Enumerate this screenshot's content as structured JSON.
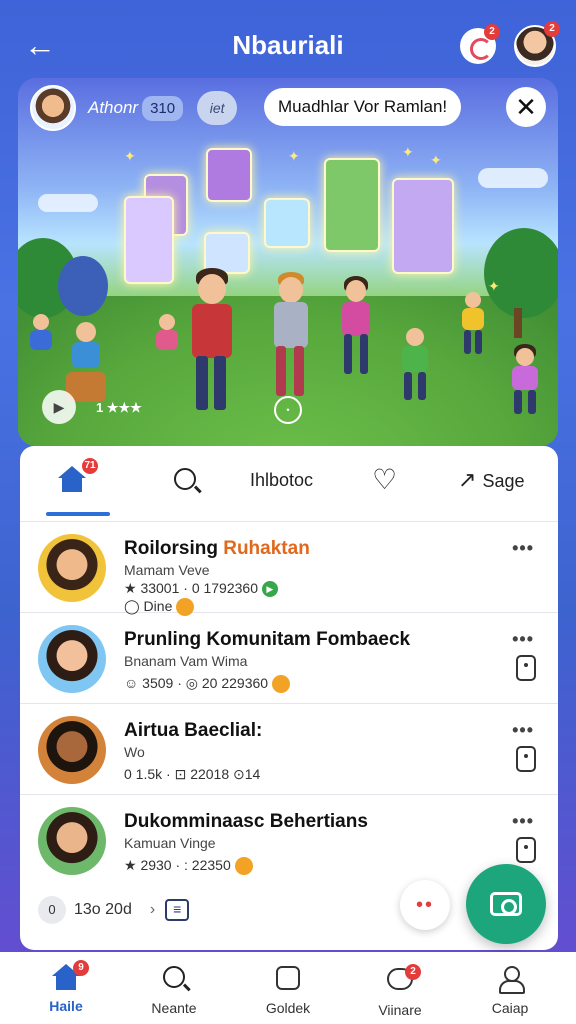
{
  "header": {
    "title": "Nbauriali",
    "back_icon": "arrow-left-icon",
    "notification_badge": "2",
    "avatar_badge": "2"
  },
  "hero": {
    "author_name": "Athonr",
    "author_count": "310",
    "author_chip": "iet",
    "announcement": "Muadhlar Vor Ramlan!",
    "close_symbol": "✕",
    "rating_text": "1 ★★★",
    "play_symbol": "▶",
    "center_symbol": "•"
  },
  "tabs": {
    "home_badge": "71",
    "middle_label": "Ihlbotoc",
    "share_label": "Sage"
  },
  "list": [
    {
      "title_main": "Roilorsing ",
      "title_highlight": "Ruhaktan",
      "subtitle": "Mamam Veve",
      "meta": "★ 33001 · 0 1792360",
      "meta2": "◯ Dine"
    },
    {
      "title_main": "Prunling Komunitam Fombaeck",
      "title_highlight": "",
      "subtitle": "Bnanam Vam Wima",
      "meta": "☺ 3509 · ◎ 20 229360",
      "meta2": ""
    },
    {
      "title_main": "Airtua Baeclial:",
      "title_highlight": "",
      "subtitle": "Wo",
      "meta": "0 1.5k · ⊡ 22018 ⊙14",
      "meta2": ""
    },
    {
      "title_main": "Dukomminaasc Behertians",
      "title_highlight": "",
      "subtitle": "Kamuan Vinge",
      "meta": "★ 2930 · : 22350",
      "meta2": ""
    }
  ],
  "footer": {
    "timer": "13o 20d",
    "clock_symbol": "0"
  },
  "bottom_nav": [
    {
      "label": "Haile",
      "badge": "9"
    },
    {
      "label": "Neante",
      "badge": ""
    },
    {
      "label": "Goldek",
      "badge": ""
    },
    {
      "label": "Viinare",
      "badge": "2"
    },
    {
      "label": "Caiap",
      "badge": ""
    }
  ],
  "colors": {
    "accent": "#2962c9",
    "fab": "#1da67c",
    "highlight": "#e0691e",
    "badge": "#e43b3b"
  }
}
